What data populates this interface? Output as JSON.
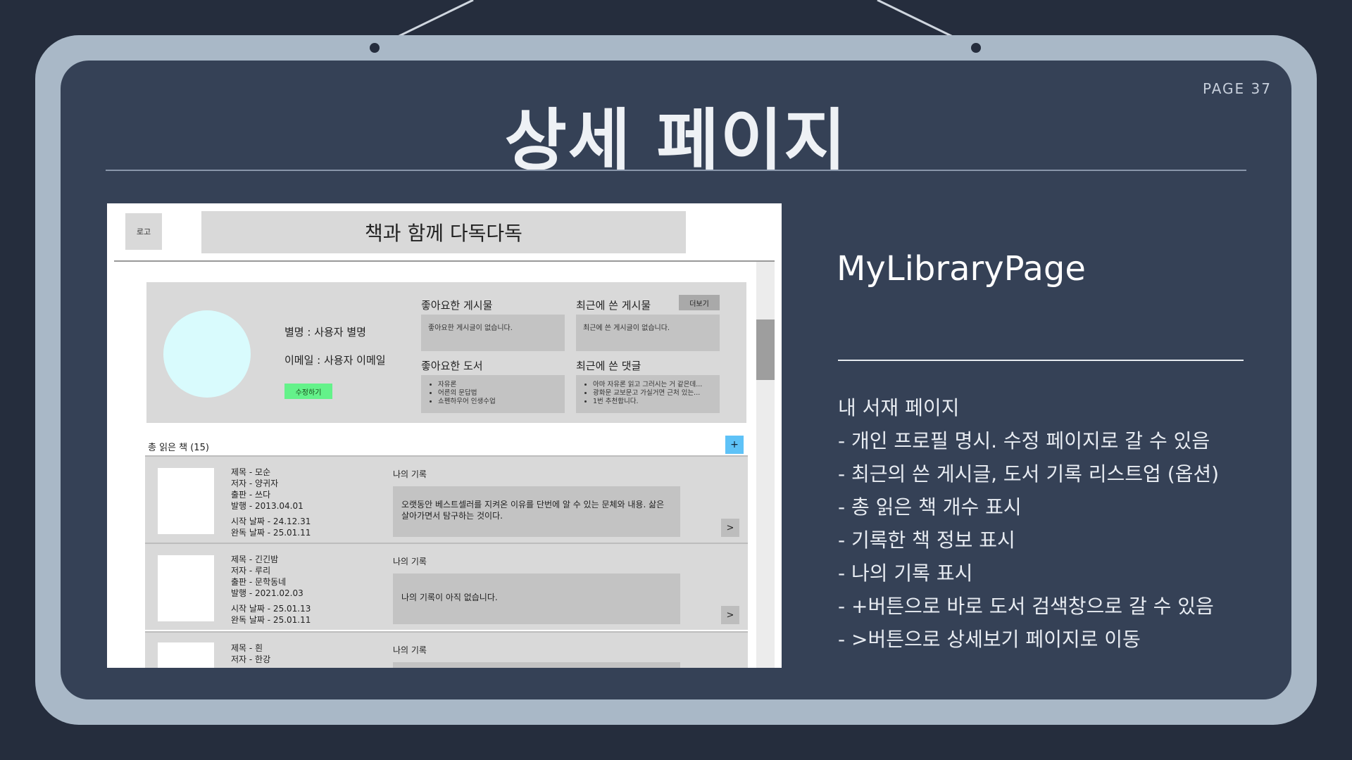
{
  "slide": {
    "page_number": "PAGE 37",
    "title": "상세 페이지"
  },
  "mockup": {
    "logo": "로고",
    "app_title": "책과 함께 다독다독",
    "profile": {
      "nickname": "별명 : 사용자 별명",
      "email": "이메일 : 사용자 이메일",
      "edit_button": "수정하기",
      "more_button": "더보기",
      "liked_posts_label": "좋아요한 게시물",
      "liked_posts_empty": "좋아요한 게시글이 없습니다.",
      "recent_posts_label": "최근에 쓴 게시물",
      "recent_posts_empty": "최근에 쓴 게시글이 없습니다.",
      "liked_books_label": "좋아요한 도서",
      "liked_books": [
        "자유론",
        "어른의 문답법",
        "쇼펜하우어 인생수업"
      ],
      "recent_comments_label": "최근에 쓴 댓글",
      "recent_comments": [
        "아마 자유론 읽고 그러시는 거 같은데...",
        "광화문 교보문고 가실거면 근처 있는...",
        "1번 추천합니다."
      ]
    },
    "total_books_label": "총 읽은 책 (15)",
    "add_button": "+",
    "books": [
      {
        "title": "제목 - 모순",
        "author": "저자 - 양귀자",
        "publisher": "출판 - 쓰다",
        "published": "발행 - 2013.04.01",
        "start": "시작 날짜 - 24.12.31",
        "finish": "완독 날짜 - 25.01.11",
        "record_label": "나의 기록",
        "record": "오랫동안 베스트셀러를 지켜온 이유를 단번에 알 수 있는 문체와 내용. 삶은 살아가면서 탐구하는 것이다.",
        "go": ">"
      },
      {
        "title": "제목 - 긴긴밤",
        "author": "저자 - 루리",
        "publisher": "출판 - 문학동네",
        "published": "발행 - 2021.02.03",
        "start": "시작 날짜 - 25.01.13",
        "finish": "완독 날짜 - 25.01.11",
        "record_label": "나의 기록",
        "record": "나의 기록이 아직 없습니다.",
        "go": ">"
      },
      {
        "title": "제목 - 흰",
        "author": "저자 - 한강",
        "record_label": "나의 기록"
      }
    ]
  },
  "description": {
    "page_name": "MyLibraryPage",
    "lines": [
      "내 서재 페이지",
      "- 개인 프로필 명시. 수정 페이지로 갈 수 있음",
      "- 최근의 쓴 게시글, 도서 기록 리스트업 (옵션)",
      "- 총 읽은 책 개수 표시",
      "- 기록한 책 정보 표시",
      "- 나의 기록 표시",
      "- +버튼으로 바로 도서 검색창으로 갈 수 있음",
      "- >버튼으로 상세보기 페이지로 이동"
    ]
  }
}
